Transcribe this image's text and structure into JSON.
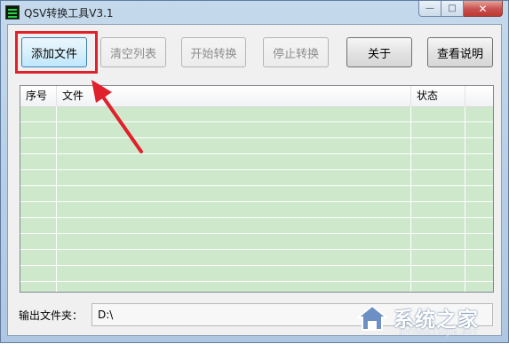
{
  "window": {
    "title": "QSV转换工具V3.1",
    "controls": {
      "minimize": "—",
      "maximize": "□",
      "close": "✕"
    }
  },
  "toolbar": {
    "buttons": [
      {
        "label": "添加文件",
        "enabled": true,
        "highlighted": true
      },
      {
        "label": "清空列表",
        "enabled": false
      },
      {
        "label": "开始转换",
        "enabled": false
      },
      {
        "label": "停止转换",
        "enabled": false
      },
      {
        "label": "关于",
        "enabled": true
      },
      {
        "label": "查看说明",
        "enabled": true
      }
    ]
  },
  "file_list": {
    "columns": [
      "序号",
      "文件",
      "状态"
    ],
    "rows": []
  },
  "output": {
    "label": "输出文件夹：",
    "value": "D:\\"
  },
  "annotation": {
    "color": "#e0202a"
  },
  "watermark": {
    "text": "系统之家",
    "subtext": "XITONGZHIJIA.NET",
    "icon": "house-logo-icon"
  },
  "colors": {
    "list_background": "#cee8cc",
    "highlight": "#e0202a"
  }
}
